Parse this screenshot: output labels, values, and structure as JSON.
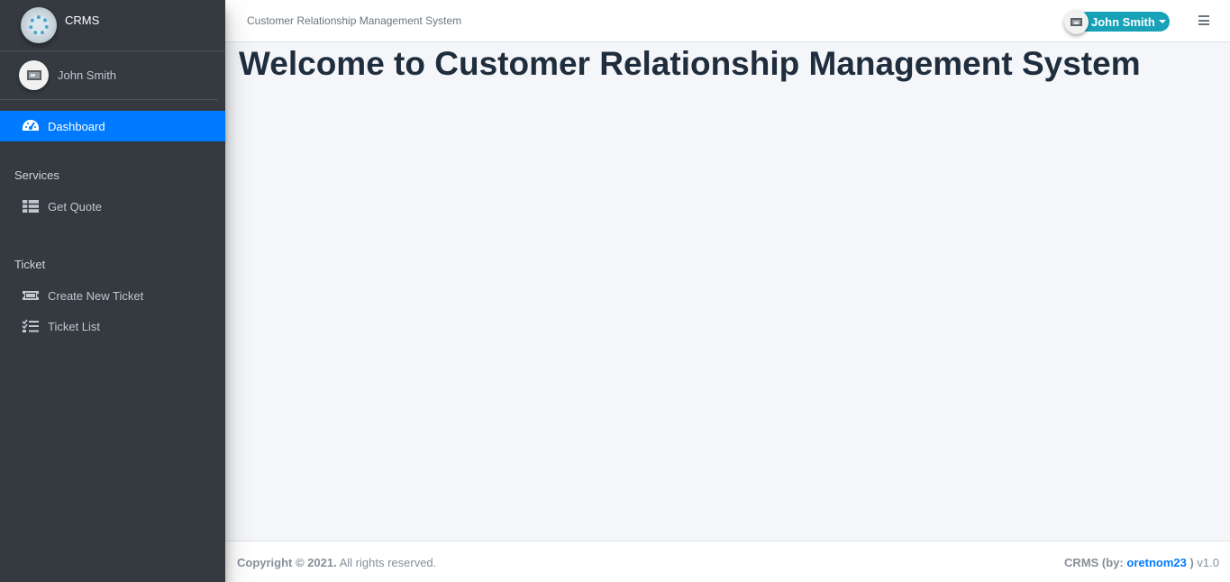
{
  "brand": {
    "name": "CRMS",
    "icon": "gear-logo-icon"
  },
  "sidebar": {
    "user": {
      "name": "John Smith"
    },
    "dashboard": {
      "label": "Dashboard",
      "icon": "speedometer-icon"
    },
    "sections": [
      {
        "header": "Services",
        "items": [
          {
            "label": "Get Quote",
            "icon": "table-icon"
          }
        ]
      },
      {
        "header": "Ticket",
        "items": [
          {
            "label": "Create New Ticket",
            "icon": "ticket-icon"
          },
          {
            "label": "Ticket List",
            "icon": "tasks-list-icon"
          }
        ]
      }
    ]
  },
  "topbar": {
    "title": "Customer Relationship Management System",
    "user_name": "John Smith"
  },
  "main": {
    "title": "Welcome to Customer Relationship Management System"
  },
  "footer": {
    "copyright": "Copyright © 2021.",
    "rights": " All rights reserved.",
    "credit_prefix": "CRMS (by: ",
    "author": "oretnom23",
    "credit_suffix": " )",
    "version": " v1.0"
  },
  "colors": {
    "sidebar_bg": "#343a40",
    "active_nav": "#007bff",
    "user_pill": "#17a2b8",
    "link": "#007bff"
  }
}
